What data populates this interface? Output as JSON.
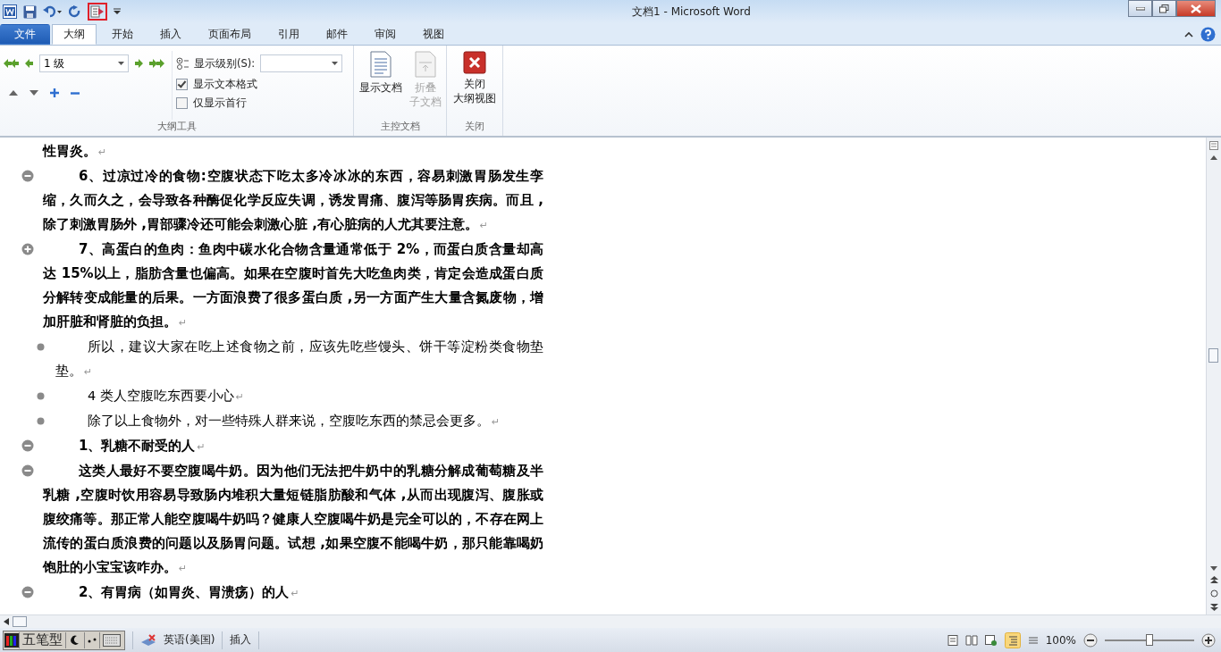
{
  "window": {
    "title": "文档1  -  Microsoft Word"
  },
  "tabs": [
    {
      "label": "文件",
      "kind": "file",
      "selected": false
    },
    {
      "label": "大纲",
      "kind": "tab",
      "selected": true
    },
    {
      "label": "开始",
      "kind": "tab",
      "selected": false
    },
    {
      "label": "插入",
      "kind": "tab",
      "selected": false
    },
    {
      "label": "页面布局",
      "kind": "tab",
      "selected": false
    },
    {
      "label": "引用",
      "kind": "tab",
      "selected": false
    },
    {
      "label": "邮件",
      "kind": "tab",
      "selected": false
    },
    {
      "label": "审阅",
      "kind": "tab",
      "selected": false
    },
    {
      "label": "视图",
      "kind": "tab",
      "selected": false
    }
  ],
  "ribbon": {
    "outline_tools": {
      "level_dropdown": "1 级",
      "show_level_label": "显示级别(S):",
      "checkboxes": [
        {
          "label": "显示文本格式",
          "checked": true
        },
        {
          "label": "仅显示首行",
          "checked": false
        }
      ],
      "group_label": "大纲工具"
    },
    "master_document": {
      "buttons": [
        {
          "lines": [
            "显示文档"
          ],
          "disabled": false
        },
        {
          "lines": [
            "折叠",
            "子文档"
          ],
          "disabled": true
        }
      ],
      "group_label": "主控文档"
    },
    "close": {
      "lines": [
        "关闭",
        "大纲视图"
      ],
      "group_label": "关闭"
    }
  },
  "paragraphs": [
    {
      "kind": "continuation",
      "text": "性胃炎。",
      "mark": "↵"
    },
    {
      "kind": "heading",
      "expanded": true,
      "text": "6、过凉过冷的食物:空腹状态下吃太多冷冰冰的东西，容易刺激胃肠发生孪缩，久而久之，会导致各种酶促化学反应失调，诱发胃痛、腹泻等肠胃疾病。而且 ,除了刺激胃肠外 ,胃部骤冷还可能会刺激心脏 ,有心脏病的人尤其要注意。",
      "mark": "↵"
    },
    {
      "kind": "heading",
      "expanded": false,
      "text": "7、高蛋白的鱼肉：鱼肉中碳水化合物含量通常低于 2%，而蛋白质含量却高达 15%以上，脂肪含量也偏高。如果在空腹时首先大吃鱼肉类，肯定会造成蛋白质分解转变成能量的后果。一方面浪费了很多蛋白质 ,另一方面产生大量含氮废物，增加肝脏和肾脏的负担。",
      "mark": "↵"
    },
    {
      "kind": "body",
      "text": "所以，建议大家在吃上述食物之前，应该先吃些馒头、饼干等淀粉类食物垫垫。",
      "mark": "↵"
    },
    {
      "kind": "body",
      "text": "4 类人空腹吃东西要小心",
      "mark": "↵"
    },
    {
      "kind": "body",
      "text": "除了以上食物外，对一些特殊人群来说，空腹吃东西的禁忌会更多。",
      "mark": "↵"
    },
    {
      "kind": "heading",
      "expanded": true,
      "text": "1、乳糖不耐受的人",
      "mark": "↵"
    },
    {
      "kind": "heading",
      "expanded": true,
      "text": "这类人最好不要空腹喝牛奶。因为他们无法把牛奶中的乳糖分解成葡萄糖及半乳糖 ,空腹时饮用容易导致肠内堆积大量短链脂肪酸和气体 ,从而出现腹泻、腹胀或腹绞痛等。那正常人能空腹喝牛奶吗？健康人空腹喝牛奶是完全可以的，不存在网上流传的蛋白质浪费的问题以及肠胃问题。试想 ,如果空腹不能喝牛奶，那只能靠喝奶饱肚的小宝宝该咋办。",
      "mark": "↵"
    },
    {
      "kind": "heading",
      "expanded": true,
      "text": "2、有胃病（如胃炎、胃溃疡）的人",
      "mark": "↵"
    }
  ],
  "status_bar": {
    "ime": "五笔型",
    "language": "英语(美国)",
    "mode": "插入",
    "zoom": "100%",
    "zoom_slider": {
      "level": 0.5
    }
  }
}
